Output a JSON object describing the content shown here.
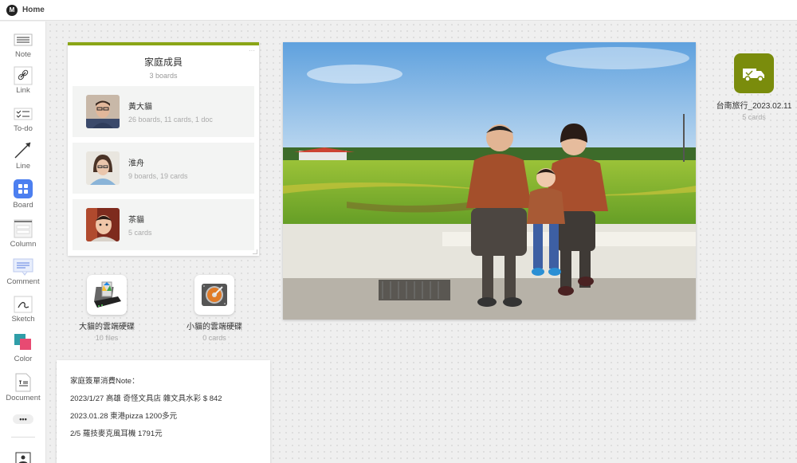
{
  "header": {
    "logo_text": "M",
    "breadcrumb": "Home"
  },
  "toolbar": {
    "items": [
      {
        "label": "Note",
        "icon": "note-icon"
      },
      {
        "label": "Link",
        "icon": "link-icon"
      },
      {
        "label": "To-do",
        "icon": "todo-icon"
      },
      {
        "label": "Line",
        "icon": "line-icon"
      },
      {
        "label": "Board",
        "icon": "board-icon"
      },
      {
        "label": "Column",
        "icon": "column-icon"
      },
      {
        "label": "Comment",
        "icon": "comment-icon"
      },
      {
        "label": "Sketch",
        "icon": "sketch-icon"
      },
      {
        "label": "Color",
        "icon": "color-icon"
      },
      {
        "label": "Document",
        "icon": "document-icon"
      }
    ],
    "more": "•••"
  },
  "board": {
    "title": "家庭成員",
    "subtitle": "3 boards",
    "accent": "#8aa516",
    "members": [
      {
        "name": "黃大貓",
        "stats": "26 boards, 11 cards, 1 doc"
      },
      {
        "name": "淮舟",
        "stats": "9 boards, 19 cards"
      },
      {
        "name": "茶貓",
        "stats": "5 cards"
      }
    ]
  },
  "drives": [
    {
      "name": "大貓的雲端硬碟",
      "sub": "10 files"
    },
    {
      "name": "小貓的雲端硬碟",
      "sub": "0 cards"
    }
  ],
  "note": {
    "lines": [
      "家庭簽單消費Note：",
      "2023/1/27 高雄 奇怪文具店  雜文具水彩   $ 842",
      "2023.01.28 東港pizza  1200多元",
      "2/5 羅技麥克風耳機  1791元"
    ]
  },
  "trip": {
    "name": "台南旅行_2023.02.11",
    "sub": "5 cards",
    "color": "#7a8c0c"
  }
}
